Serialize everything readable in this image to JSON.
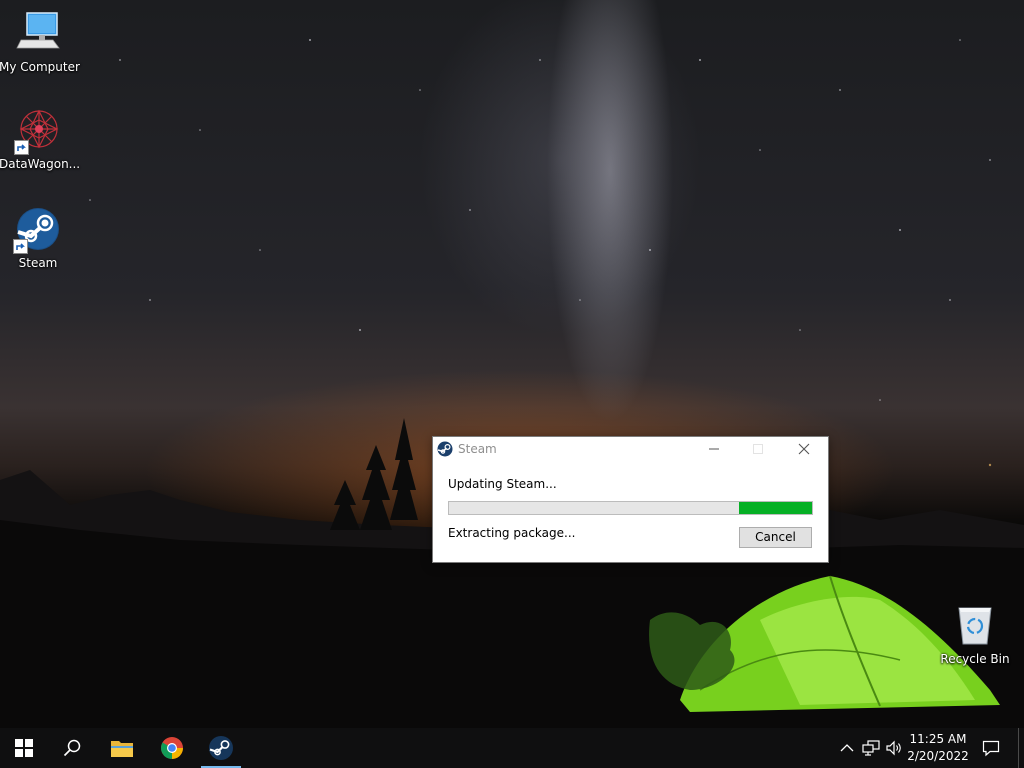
{
  "desktop": {
    "icons": [
      {
        "label": "My Computer"
      },
      {
        "label": "DataWagon..."
      },
      {
        "label": "Steam"
      },
      {
        "label": "Recycle Bin"
      }
    ]
  },
  "dialog": {
    "title": "Steam",
    "heading": "Updating Steam...",
    "status": "Extracting package...",
    "progress_percent": 20,
    "cancel_label": "Cancel"
  },
  "taskbar": {
    "pinned": [
      "start-icon",
      "search-icon",
      "file-explorer-icon",
      "chrome-icon",
      "steam-icon"
    ],
    "active": "steam-icon",
    "time": "11:25 AM",
    "date": "2/20/2022",
    "tray": [
      "chevron-up-icon",
      "network-icon",
      "volume-icon",
      "notification-icon"
    ]
  },
  "colors": {
    "progress": "#06b025",
    "taskbar": "#0f0f10",
    "active_indicator": "#76b9ed"
  }
}
